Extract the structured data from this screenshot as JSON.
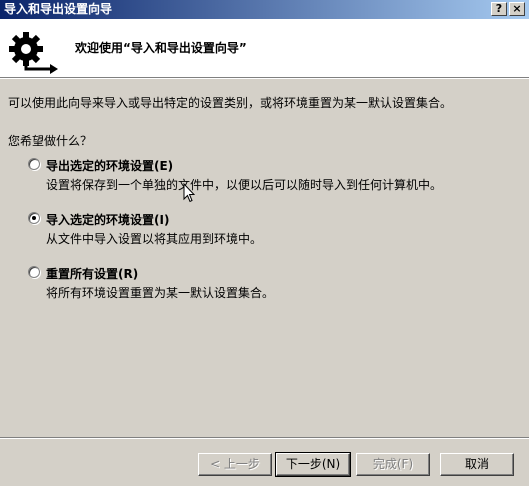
{
  "window": {
    "title": "导入和导出设置向导",
    "help_button": "?",
    "close_button": "×"
  },
  "header": {
    "title": "欢迎使用“导入和导出设置向导”",
    "icon": "gear-export-icon"
  },
  "intro_text": "可以使用此向导来导入或导出特定的设置类别，或将环境重置为某一默认设置集合。",
  "question": "您希望做什么？",
  "options": [
    {
      "label": "导出选定的环境设置(E)",
      "description": "设置将保存到一个单独的文件中，以便以后可以随时导入到任何计算机中。",
      "checked": false
    },
    {
      "label": "导入选定的环境设置(I)",
      "description": "从文件中导入设置以将其应用到环境中。",
      "checked": true
    },
    {
      "label": "重置所有设置(R)",
      "description": "将所有环境设置重置为某一默认设置集合。",
      "checked": false
    }
  ],
  "buttons": {
    "back": "< 上一步",
    "next": "下一步(N)",
    "finish": "完成(F)",
    "cancel": "取消"
  },
  "colors": {
    "titlebar_start": "#0a246a",
    "titlebar_end": "#a6caf0",
    "dialog_bg": "#d4d0c8"
  }
}
